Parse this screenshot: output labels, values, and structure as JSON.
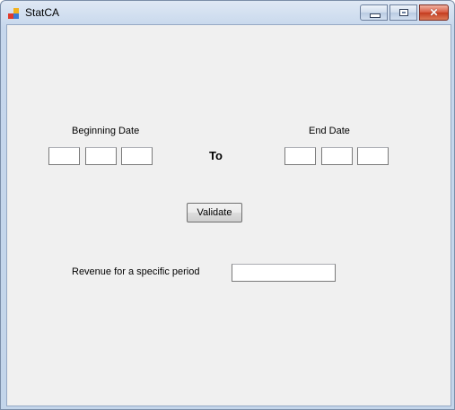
{
  "window": {
    "title": "StatCA",
    "icon": "app-form-icon",
    "controls": {
      "minimize": "minimize-icon",
      "maximize": "maximize-icon",
      "close": "close-icon",
      "close_glyph": "✕"
    }
  },
  "form": {
    "beginning_date_label": "Beginning Date",
    "end_date_label": "End Date",
    "to_label": "To",
    "beginning_date_fields": [
      "",
      "",
      ""
    ],
    "end_date_fields": [
      "",
      "",
      ""
    ],
    "validate_button": "Validate",
    "revenue_label": "Revenue for a specific period",
    "revenue_value": ""
  },
  "colors": {
    "client_background": "#f0f0f0",
    "close_button": "#c43b1f"
  }
}
